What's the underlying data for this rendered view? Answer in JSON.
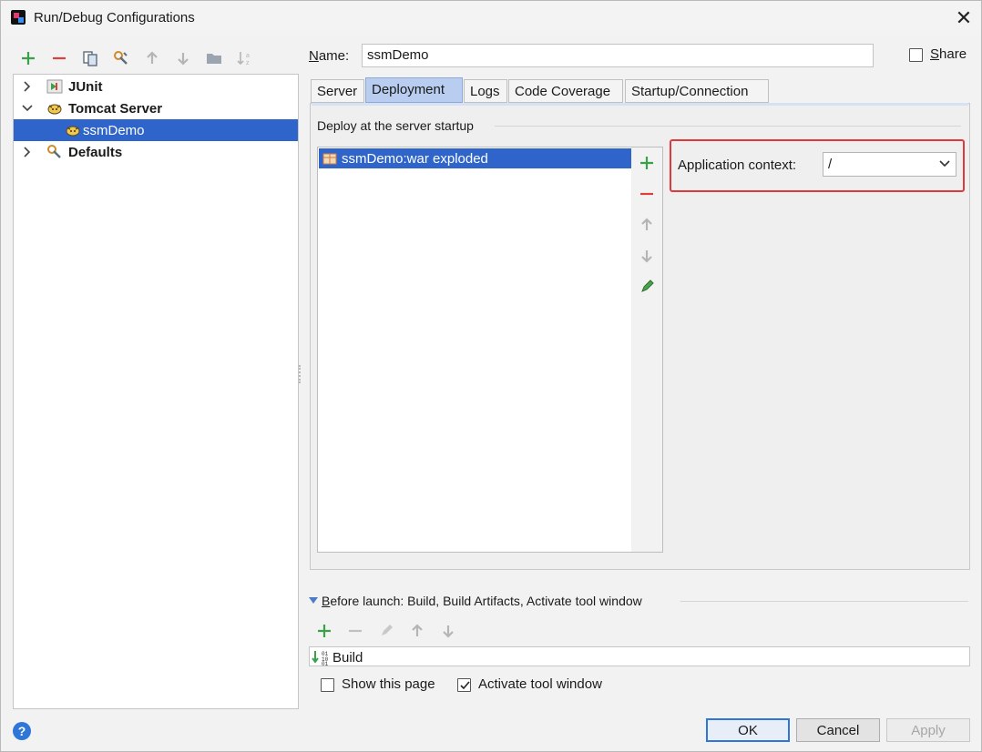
{
  "window": {
    "title": "Run/Debug Configurations",
    "close_glyph": "✕"
  },
  "toolbar": {
    "icons": [
      "add-icon",
      "remove-icon",
      "copy-icon",
      "wrench-icon",
      "arrow-up-icon",
      "arrow-down-icon",
      "folder-icon",
      "sort-az-icon"
    ]
  },
  "tree": {
    "items": [
      {
        "label": "JUnit",
        "bold": true,
        "expanded": false
      },
      {
        "label": "Tomcat Server",
        "bold": true,
        "expanded": true
      },
      {
        "label": "ssmDemo",
        "bold": false,
        "selected": true
      },
      {
        "label": "Defaults",
        "bold": true,
        "expanded": false
      }
    ]
  },
  "name_row": {
    "label_prefix": "N",
    "label_rest": "ame:",
    "value": "ssmDemo"
  },
  "share": {
    "label_prefix": "S",
    "label_rest": "hare",
    "checked": false
  },
  "tabs": [
    {
      "label": "Server",
      "active": false
    },
    {
      "label": "Deployment",
      "active": true
    },
    {
      "label": "Logs",
      "active": false
    },
    {
      "label": "Code Coverage",
      "active": false
    },
    {
      "label": "Startup/Connection",
      "active": false
    }
  ],
  "deployment": {
    "section_title": "Deploy at the server startup",
    "artifacts": [
      {
        "label": "ssmDemo:war exploded"
      }
    ],
    "app_context_label": "Application context:",
    "app_context_value": "/"
  },
  "before_launch": {
    "title_prefix": "B",
    "title_rest": "efore launch: Build, Build Artifacts, Activate tool window",
    "tasks": [
      {
        "label": "Build"
      }
    ],
    "show_page_label": "Show this page",
    "show_page_checked": false,
    "activate_label": "Activate tool window",
    "activate_checked": true
  },
  "buttons": {
    "ok": "OK",
    "cancel": "Cancel",
    "apply": "Apply"
  },
  "help_glyph": "?",
  "colors": {
    "selection": "#2f65ca",
    "add_green": "#3aa14a",
    "remove_red": "#d9413a",
    "highlight_red": "#e0393b"
  }
}
